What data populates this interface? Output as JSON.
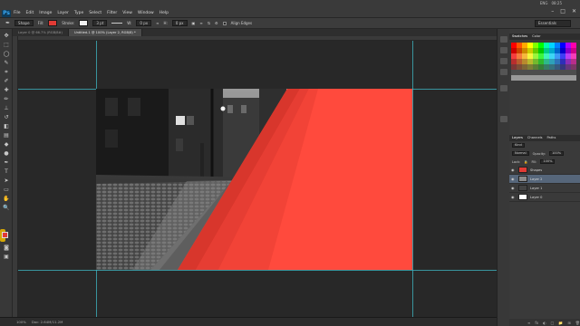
{
  "app": {
    "logo": "Ps"
  },
  "menu": [
    "File",
    "Edit",
    "Image",
    "Layer",
    "Type",
    "Select",
    "Filter",
    "View",
    "Window",
    "Help"
  ],
  "tray": {
    "lang": "ENG",
    "time": "08:25"
  },
  "window_controls": [
    "–",
    "□",
    "✕"
  ],
  "options": {
    "shape_mode": "Shape",
    "fill_label": "Fill:",
    "stroke_label": "Stroke:",
    "stroke_width": "3 pt",
    "w_label": "W:",
    "w_value": "0 px",
    "h_label": "H:",
    "h_value": "0 px",
    "align_edges": "Align Edges",
    "workspace": "Essentials"
  },
  "tabs": [
    {
      "label": "Layer 0 @ 66.7% (RGB/8#)"
    },
    {
      "label": "Untitled-1 @ 100% (Layer 2, RGB/8) *"
    }
  ],
  "status": {
    "zoom": "100%",
    "doc": "Doc: 2.64M/11.2M"
  },
  "panels": {
    "swatches_tabs": [
      "Swatches",
      "Color"
    ],
    "layers_tabs": [
      "Layers",
      "Channels",
      "Paths"
    ],
    "kind": "Kind",
    "blend": "Normal",
    "opacity_label": "Opacity:",
    "opacity": "100%",
    "lock_label": "Lock:",
    "fill_label": "Fill:",
    "fill": "100%",
    "layers": [
      {
        "name": "Shapes",
        "selected": false,
        "thumb": "#e13b35"
      },
      {
        "name": "Layer 2",
        "selected": true,
        "thumb": "#8a8a8a"
      },
      {
        "name": "Layer 1",
        "selected": false,
        "thumb": "#444444"
      },
      {
        "name": "Layer 0",
        "selected": false,
        "thumb": "#ffffff"
      }
    ],
    "footer_icons": [
      "∞",
      "fx",
      "◐",
      "□",
      "📁",
      "⊞",
      "🗑"
    ]
  },
  "colors": {
    "accent_red": "#ff4a3d",
    "fg": "#e13b35",
    "bg": "#ffffff",
    "guide": "#3fb8c6"
  }
}
